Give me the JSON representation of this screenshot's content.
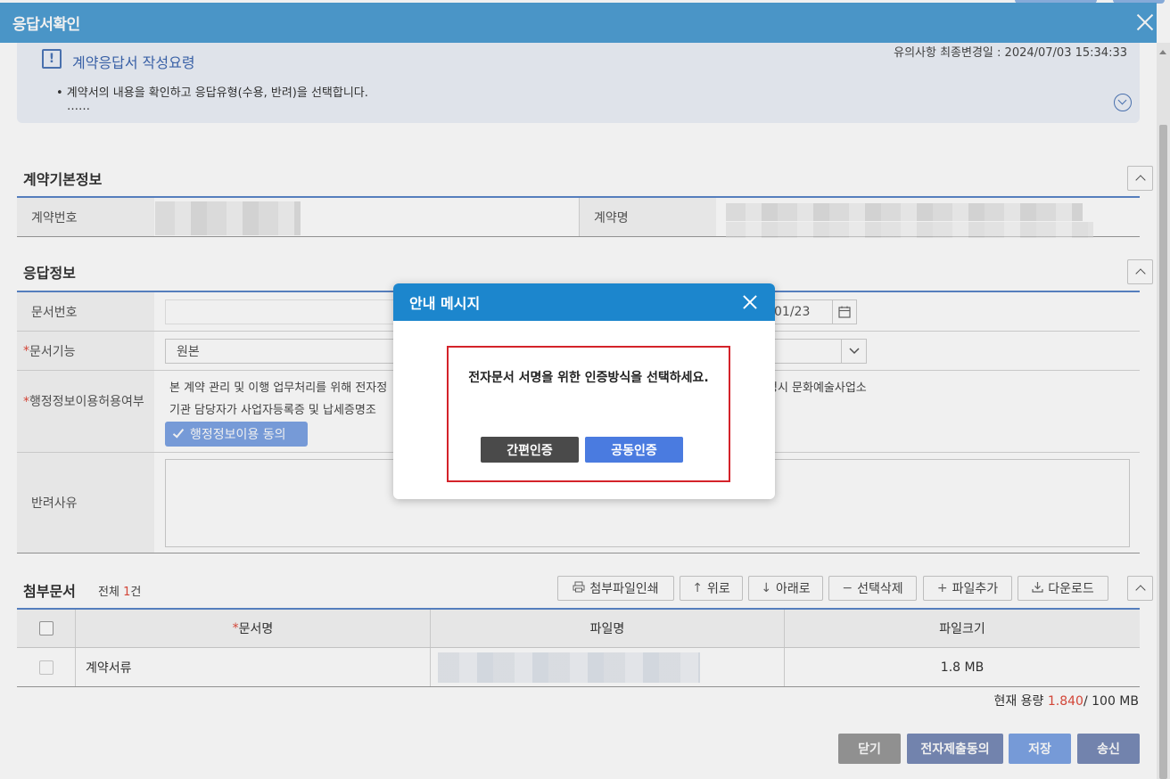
{
  "window": {
    "title": "응답서확인"
  },
  "notice": {
    "icon": "!",
    "title": "계약응답서 작성요령",
    "updated": "유의사항 최종변경일 : 2024/07/03 15:34:33",
    "line1": "• 계약서의 내용을 확인하고 응답유형(수용, 반려)을 선택합니다.",
    "line2": "……"
  },
  "basic": {
    "title": "계약기본정보",
    "contract_no_label": "계약번호",
    "contract_name_label": "계약명"
  },
  "response": {
    "title": "응답정보",
    "doc_no_label": "문서번호",
    "doc_func_label": "문서기능",
    "doc_func_value": "원본",
    "date_fragment": "01/23",
    "admin_label": "행정정보이용허용여부",
    "admin_text_1": "본 계약 관리 및 이행 업무처리를 위해 전자정",
    "admin_text_1_tail": "성시 문화예술사업소",
    "admin_text_2": "기관 담당자가 사업자등록증 및 납세증명조",
    "agree_button": "행정정보이용 동의",
    "reject_label": "반려사유",
    "required_mark": "*"
  },
  "attachments": {
    "title": "첨부문서",
    "total_prefix": "전체",
    "total_count": "1",
    "total_suffix": "건",
    "toolbar": {
      "print": "첨부파일인쇄",
      "up": "위로",
      "down": "아래로",
      "delete": "선택삭제",
      "add": "파일추가",
      "download": "다운로드"
    },
    "columns": {
      "doc_name": "문서명",
      "file_name": "파일명",
      "file_size": "파일크기"
    },
    "rows": [
      {
        "doc_name": "계약서류",
        "file_size": "1.8 MB"
      }
    ],
    "capacity_label": "현재 용량",
    "capacity_used": "1.840",
    "capacity_total": "/ 100 MB"
  },
  "actions": {
    "close": "닫기",
    "consent": "전자제출동의",
    "save": "저장",
    "send": "송신"
  },
  "modal": {
    "title": "안내 메시지",
    "message": "전자문서 서명을 위한 인증방식을 선택하세요.",
    "simple_auth": "간편인증",
    "joint_auth": "공동인증"
  },
  "colors": {
    "header": "#4f9fd4",
    "modal_header": "#1c86cd",
    "highlight_frame": "#d4232a",
    "accent_blue": "#5b86c9"
  }
}
